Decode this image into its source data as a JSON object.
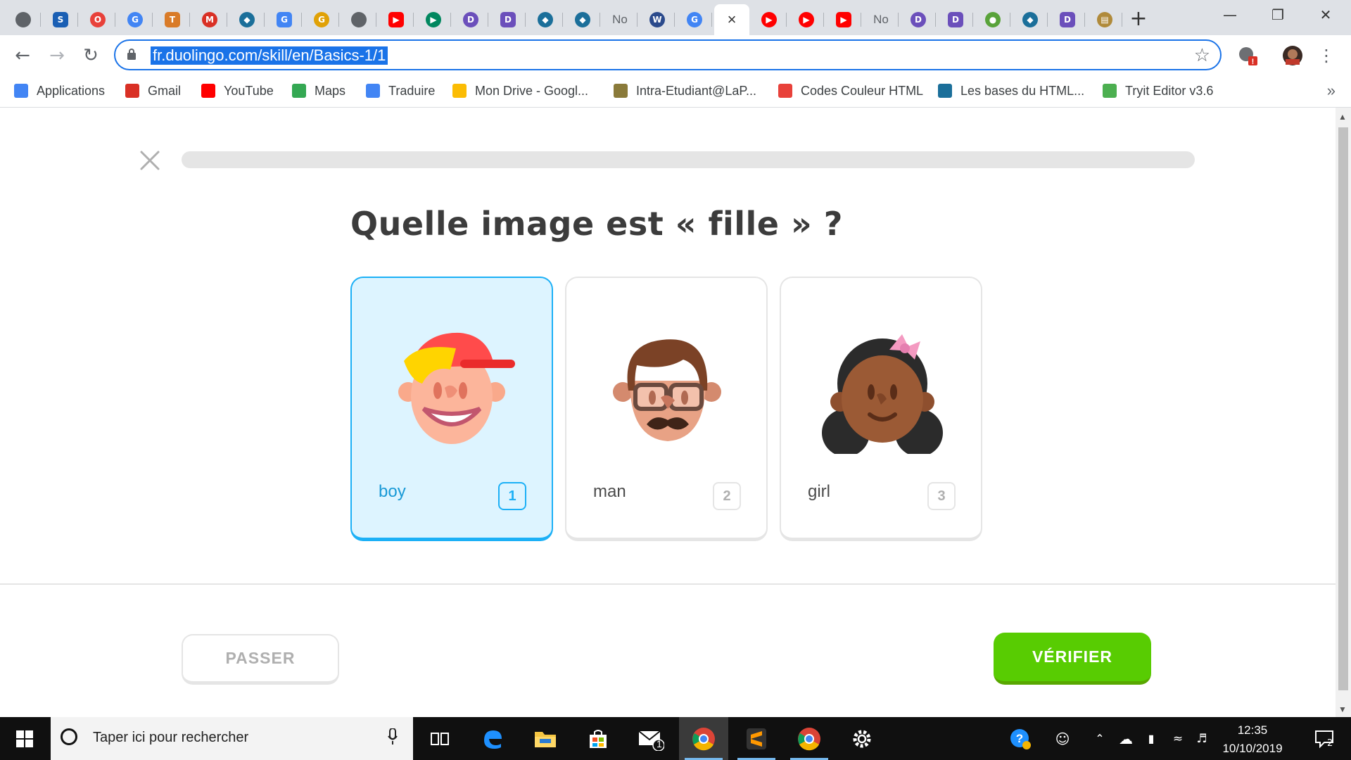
{
  "browser": {
    "tabs": [
      {
        "icon": "globe-icon",
        "color": "#5f6368",
        "glyph": ""
      },
      {
        "icon": "s-logo-icon",
        "color": "#1a5fb4",
        "glyph": "S"
      },
      {
        "icon": "opera-icon",
        "color": "#e8413a",
        "glyph": "O"
      },
      {
        "icon": "google-icon",
        "color": "#4285f4",
        "glyph": "G"
      },
      {
        "icon": "colorful-logo-icon",
        "color": "#d97b28",
        "glyph": "T"
      },
      {
        "icon": "gmail-icon",
        "color": "#d93025",
        "glyph": "M"
      },
      {
        "icon": "bird-logo-icon",
        "color": "#1b6f9a",
        "glyph": "◆"
      },
      {
        "icon": "google-icon",
        "color": "#4285f4",
        "glyph": "G"
      },
      {
        "icon": "yellow-logo-icon",
        "color": "#e0a106",
        "glyph": "G"
      },
      {
        "icon": "globe-icon",
        "color": "#5f6368",
        "glyph": ""
      },
      {
        "icon": "youtube-icon",
        "color": "#ff0000",
        "glyph": "▶"
      },
      {
        "icon": "play-store-icon",
        "color": "#01875f",
        "glyph": "▶"
      },
      {
        "icon": "purple-app-icon",
        "color": "#6b4fbb",
        "glyph": "D"
      },
      {
        "icon": "purple-app-icon",
        "color": "#6b4fbb",
        "glyph": "D"
      },
      {
        "icon": "bird-logo-icon",
        "color": "#1b6f9a",
        "glyph": "◆"
      },
      {
        "icon": "bird-logo-icon",
        "color": "#1b6f9a",
        "glyph": "◆"
      },
      {
        "icon": "notion-tab",
        "color": "",
        "glyph": "",
        "title": "No"
      },
      {
        "icon": "flag-logo-icon",
        "color": "#2b4a8c",
        "glyph": "W"
      },
      {
        "icon": "google-icon",
        "color": "#4285f4",
        "glyph": "G"
      },
      {
        "icon": "close-tab-icon",
        "color": "",
        "glyph": "×",
        "active": true
      },
      {
        "icon": "youtube-icon",
        "color": "#ff0000",
        "glyph": "▶"
      },
      {
        "icon": "youtube-icon",
        "color": "#ff0000",
        "glyph": "▶"
      },
      {
        "icon": "youtube-icon",
        "color": "#ff0000",
        "glyph": "▶"
      },
      {
        "icon": "notion-tab",
        "color": "",
        "glyph": "",
        "title": "No"
      },
      {
        "icon": "purple-app-icon",
        "color": "#6b4fbb",
        "glyph": "D"
      },
      {
        "icon": "purple-app-icon",
        "color": "#6b4fbb",
        "glyph": "D"
      },
      {
        "icon": "green-app-icon",
        "color": "#59a33a",
        "glyph": "●"
      },
      {
        "icon": "bird-logo-icon",
        "color": "#1b6f9a",
        "glyph": "◆"
      },
      {
        "icon": "purple-app-icon",
        "color": "#6b4fbb",
        "glyph": "D"
      },
      {
        "icon": "clapper-icon",
        "color": "#b08a3a",
        "glyph": "▤"
      }
    ],
    "new_tab_glyph": "+",
    "url": "fr.duolingo.com/skill/en/Basics-1/1",
    "bookmarks": [
      {
        "label": "Applications",
        "icon": "apps-grid-icon",
        "color": "#4285f4"
      },
      {
        "label": "Gmail",
        "icon": "gmail-icon",
        "color": "#d93025"
      },
      {
        "label": "YouTube",
        "icon": "youtube-icon",
        "color": "#ff0000"
      },
      {
        "label": "Maps",
        "icon": "maps-icon",
        "color": "#34a853"
      },
      {
        "label": "Traduire",
        "icon": "translate-icon",
        "color": "#4285f4"
      },
      {
        "label": "Mon Drive - Googl...",
        "icon": "drive-icon",
        "color": "#fbbc04"
      },
      {
        "label": "Intra-Etudiant@LaP...",
        "icon": "intra-icon",
        "color": "#8a7a3a"
      },
      {
        "label": "Codes Couleur HTML",
        "icon": "color-wheel-icon",
        "color": "#e8413a"
      },
      {
        "label": "Les bases du HTML...",
        "icon": "bird-logo-icon",
        "color": "#1b6f9a"
      },
      {
        "label": "Tryit Editor v3.6",
        "icon": "w3-icon",
        "color": "#4caf50"
      }
    ],
    "bookmarks_more": "»"
  },
  "lesson": {
    "question": "Quelle image est « fille » ?",
    "progress": 0,
    "choices": [
      {
        "word": "boy",
        "key": "1",
        "selected": true
      },
      {
        "word": "man",
        "key": "2",
        "selected": false
      },
      {
        "word": "girl",
        "key": "3",
        "selected": false
      }
    ],
    "skip_label": "PASSER",
    "check_label": "VÉRIFIER"
  },
  "colors": {
    "selected_bg": "#ddf4ff",
    "selected_border": "#1cb0f6",
    "check_green": "#58cc02",
    "chrome_tabstrip": "#dee1e6"
  },
  "taskbar": {
    "search_placeholder": "Taper ici pour rechercher",
    "mail_badge": "1",
    "time": "12:35",
    "date": "10/10/2019",
    "notification_count": "2"
  }
}
